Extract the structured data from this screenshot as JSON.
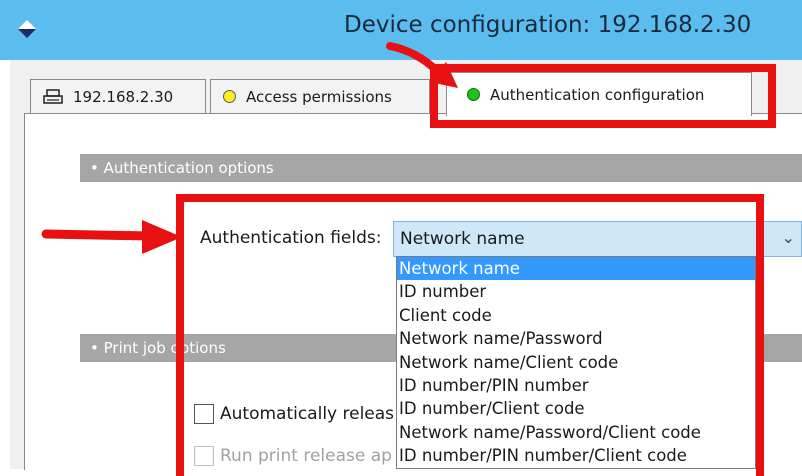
{
  "window": {
    "title": "Device configuration: 192.168.2.30"
  },
  "tabs": [
    {
      "label": "192.168.2.30",
      "icon": "printer-icon"
    },
    {
      "label": "Access permissions",
      "icon": "yellow-status-dot-icon"
    },
    {
      "label": "Authentication configuration",
      "icon": "green-status-dot-icon",
      "active": true
    }
  ],
  "sections": {
    "auth_options": "• Authentication options",
    "print_job_options": "• Print job options"
  },
  "auth_fields": {
    "label": "Authentication fields:",
    "selected": "Network name",
    "options": [
      "Network name",
      "ID number",
      "Client code",
      "Network name/Password",
      "Network name/Client code",
      "ID number/PIN number",
      "ID number/Client code",
      "Network name/Password/Client code",
      "ID number/PIN number/Client code"
    ]
  },
  "checkboxes": [
    {
      "label": "Automatically releas",
      "checked": false,
      "enabled": true
    },
    {
      "label": "Run print release ap",
      "checked": false,
      "enabled": false
    }
  ],
  "colors": {
    "titlebar": "#5bbcf0",
    "highlight_red": "#e81010",
    "selection_blue": "#3399ff",
    "section_gray": "#a6a6a6"
  }
}
